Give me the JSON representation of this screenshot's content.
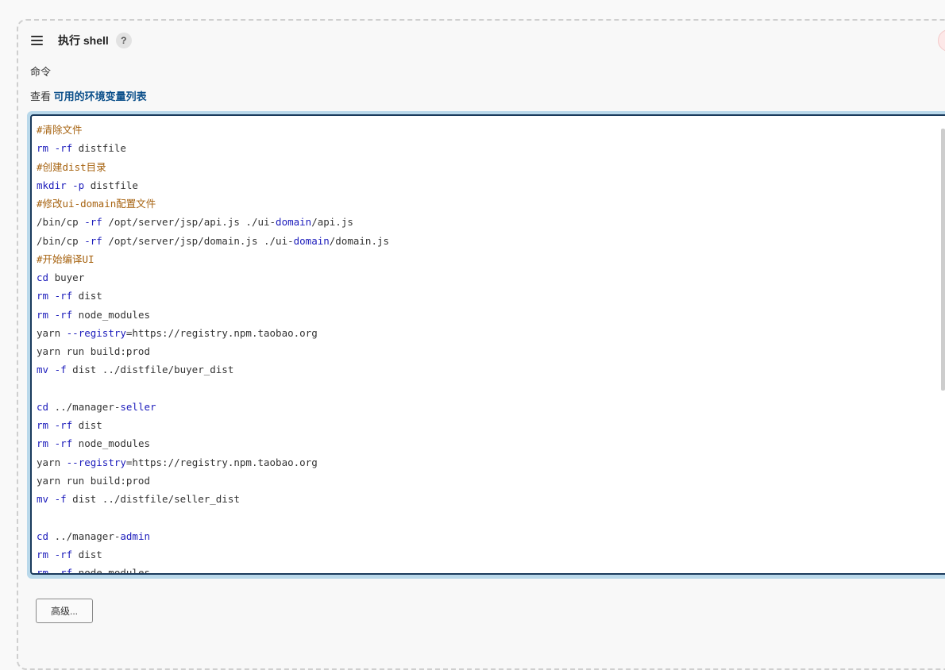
{
  "step": {
    "title": "执行 shell",
    "help_symbol": "?",
    "command_label": "命令",
    "env_prefix": "查看",
    "env_link": "可用的环境变量列表",
    "advanced_button": "高级..."
  },
  "editor": {
    "lines": [
      [
        {
          "t": "#清除文件",
          "c": "comment"
        }
      ],
      [
        {
          "t": "rm -rf",
          "c": "kw"
        },
        {
          "t": " distfile",
          "c": "plain"
        }
      ],
      [
        {
          "t": "#创建dist目录",
          "c": "comment"
        }
      ],
      [
        {
          "t": "mkdir -p",
          "c": "kw"
        },
        {
          "t": " distfile",
          "c": "plain"
        }
      ],
      [
        {
          "t": "#修改ui-domain配置文件",
          "c": "comment"
        }
      ],
      [
        {
          "t": "/bin/cp ",
          "c": "plain"
        },
        {
          "t": "-rf",
          "c": "kw"
        },
        {
          "t": " /opt/server/jsp/api.js ./ui-",
          "c": "plain"
        },
        {
          "t": "domain",
          "c": "kw"
        },
        {
          "t": "/api.js",
          "c": "plain"
        }
      ],
      [
        {
          "t": "/bin/cp ",
          "c": "plain"
        },
        {
          "t": "-rf",
          "c": "kw"
        },
        {
          "t": " /opt/server/jsp/domain.js ./ui-",
          "c": "plain"
        },
        {
          "t": "domain",
          "c": "kw"
        },
        {
          "t": "/domain.js",
          "c": "plain"
        }
      ],
      [
        {
          "t": "#开始编译UI",
          "c": "comment"
        }
      ],
      [
        {
          "t": "cd",
          "c": "kw"
        },
        {
          "t": " buyer",
          "c": "plain"
        }
      ],
      [
        {
          "t": "rm -rf",
          "c": "kw"
        },
        {
          "t": " dist",
          "c": "plain"
        }
      ],
      [
        {
          "t": "rm -rf",
          "c": "kw"
        },
        {
          "t": " node_modules",
          "c": "plain"
        }
      ],
      [
        {
          "t": "yarn ",
          "c": "plain"
        },
        {
          "t": "--registry",
          "c": "kw"
        },
        {
          "t": "=https://registry.npm.taobao.org",
          "c": "plain"
        }
      ],
      [
        {
          "t": "yarn run build:prod",
          "c": "plain"
        }
      ],
      [
        {
          "t": "mv -f",
          "c": "kw"
        },
        {
          "t": " dist ../distfile/buyer_dist",
          "c": "plain"
        }
      ],
      [],
      [
        {
          "t": "cd",
          "c": "kw"
        },
        {
          "t": " ../manager-",
          "c": "plain"
        },
        {
          "t": "seller",
          "c": "kw"
        }
      ],
      [
        {
          "t": "rm -rf",
          "c": "kw"
        },
        {
          "t": " dist",
          "c": "plain"
        }
      ],
      [
        {
          "t": "rm -rf",
          "c": "kw"
        },
        {
          "t": " node_modules",
          "c": "plain"
        }
      ],
      [
        {
          "t": "yarn ",
          "c": "plain"
        },
        {
          "t": "--registry",
          "c": "kw"
        },
        {
          "t": "=https://registry.npm.taobao.org",
          "c": "plain"
        }
      ],
      [
        {
          "t": "yarn run build:prod",
          "c": "plain"
        }
      ],
      [
        {
          "t": "mv -f",
          "c": "kw"
        },
        {
          "t": " dist ../distfile/seller_dist",
          "c": "plain"
        }
      ],
      [],
      [
        {
          "t": "cd",
          "c": "kw"
        },
        {
          "t": " ../manager-",
          "c": "plain"
        },
        {
          "t": "admin",
          "c": "kw"
        }
      ],
      [
        {
          "t": "rm -rf",
          "c": "kw"
        },
        {
          "t": " dist",
          "c": "plain"
        }
      ],
      [
        {
          "t": "rm -rf",
          "c": "kw"
        },
        {
          "t": " node_modules",
          "c": "plain"
        }
      ]
    ],
    "colors": {
      "comment": "#a6620f",
      "kw": "#1b1bbb",
      "plain": "#333333"
    }
  }
}
